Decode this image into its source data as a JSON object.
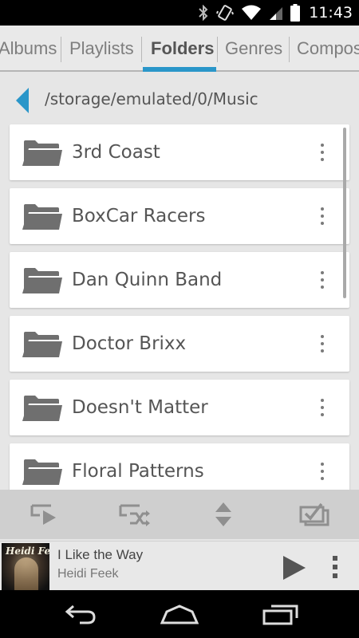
{
  "status_bar": {
    "time": "11:43",
    "icons": [
      "bluetooth-icon",
      "vibrate-icon",
      "wifi-icon",
      "signal-icon",
      "battery-icon"
    ]
  },
  "tabs": [
    {
      "label": "Albums",
      "active": false
    },
    {
      "label": "Playlists",
      "active": false
    },
    {
      "label": "Folders",
      "active": true
    },
    {
      "label": "Genres",
      "active": false
    },
    {
      "label": "Composers",
      "active": false
    }
  ],
  "path": {
    "text": "/storage/emulated/0/Music",
    "back_icon": "back-triangle-icon"
  },
  "folders": [
    {
      "name": "3rd Coast"
    },
    {
      "name": "BoxCar Racers"
    },
    {
      "name": "Dan Quinn Band"
    },
    {
      "name": "Doctor Brixx"
    },
    {
      "name": "Doesn't Matter"
    },
    {
      "name": "Floral Patterns"
    }
  ],
  "toolbar": {
    "buttons": [
      "play-all-icon",
      "shuffle-all-icon",
      "sort-icon",
      "select-all-icon"
    ]
  },
  "now_playing": {
    "title": "I Like the Way",
    "artist": "Heidi Feek",
    "album_art_text": "Heidi Feek"
  },
  "nav_bar": {
    "buttons": [
      "back-icon",
      "home-icon",
      "recent-apps-icon"
    ]
  },
  "colors": {
    "accent": "#2a96c9",
    "background": "#e6e6e6",
    "card": "#ffffff",
    "toolbar": "#cfcfcf"
  }
}
